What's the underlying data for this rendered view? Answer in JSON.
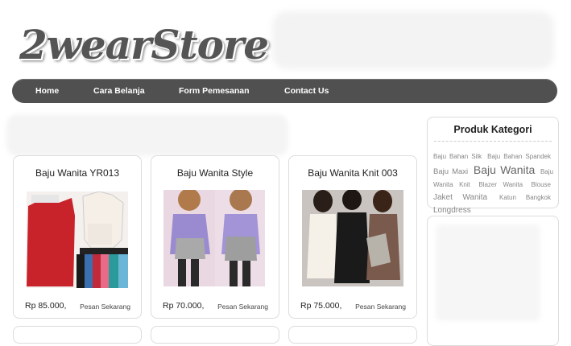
{
  "header": {
    "logo_text": "2wearStore"
  },
  "nav": {
    "items": [
      "Home",
      "Cara Belanja",
      "Form Pemesanan",
      "Contact Us"
    ]
  },
  "products": [
    {
      "title": "Baju Wanita YR013",
      "price": "Rp 85.000,",
      "order_label": "Pesan Sekarang"
    },
    {
      "title": "Baju Wanita Style",
      "price": "Rp 70.000,",
      "order_label": "Pesan Sekarang"
    },
    {
      "title": "Baju Wanita Knit 003",
      "price": "Rp 75.000,",
      "order_label": "Pesan Sekarang"
    }
  ],
  "sidebar": {
    "category_title": "Produk Kategori",
    "tags": [
      "Baju Bahan Silk",
      "Baju Bahan Spandek",
      "Baju Maxi",
      "Baju Wanita",
      "Baju Wanita Knit",
      "Blazer Wanita",
      "Blouse",
      "Jaket Wanita",
      "Katun Bangkok",
      "Longdress"
    ]
  },
  "colors": {
    "nav_bg": "#505050",
    "card_border": "#dcdcdc",
    "logo": "#555555"
  }
}
